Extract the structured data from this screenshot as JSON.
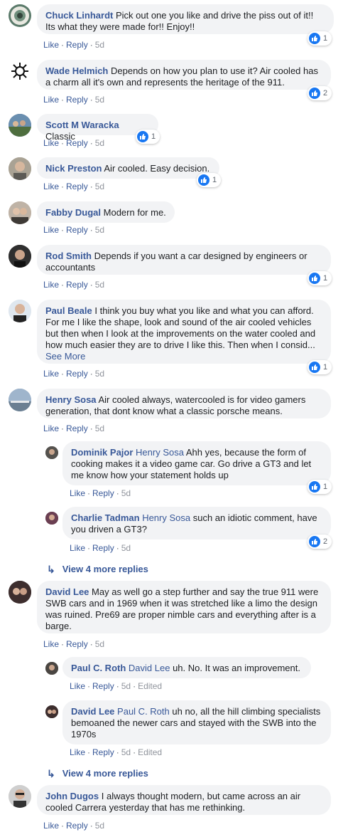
{
  "colors": {
    "link": "#385898",
    "bubble": "#f2f3f5",
    "like": "#1877f2",
    "meta": "#606770"
  },
  "actions": {
    "like": "Like",
    "reply": "Reply",
    "sep": "·"
  },
  "comments": [
    {
      "author": "Chuck Linhardt",
      "text": "Pick out one you like and drive the piss out of it!! Its what they were made for!! Enjoy!!",
      "time": "5d",
      "reactions": "1"
    },
    {
      "author": "Wade Helmich",
      "text": "Depends on how you plan to use it? Air cooled has a charm all it's own and represents the heritage of the 911.",
      "time": "5d",
      "reactions": "2"
    },
    {
      "author": "Scott M Waracka",
      "text": "Classic",
      "time": "5d",
      "reactions": "1"
    },
    {
      "author": "Nick Preston",
      "text": "Air cooled. Easy decision.",
      "time": "5d",
      "reactions": "1"
    },
    {
      "author": "Fabby Dugal",
      "text": "Modern for me.",
      "time": "5d"
    },
    {
      "author": "Rod Smith",
      "text": "Depends if you want a car designed by engineers or accountants",
      "time": "5d",
      "reactions": "1"
    },
    {
      "author": "Paul Beale",
      "text": "I think you buy what you like and what you can afford. For me I like the shape, look and sound of the air cooled vehicles but then when I look at the improvements on the water cooled and how much easier they are to drive I like this. Then when I consid...",
      "see_more": "See More",
      "time": "5d",
      "reactions": "1"
    },
    {
      "author": "Henry Sosa",
      "text": "Air cooled always, watercooled is for video gamers generation, that dont know what a classic porsche means.",
      "time": "5d"
    },
    {
      "author": "David Lee",
      "text": "May as well go a step further and say the true 911 were SWB cars and in 1969 when it was stretched like a limo the design was ruined. Pre69 are proper nimble cars and everything after is a barge.",
      "time": "5d"
    },
    {
      "author": "John Dugos",
      "text": "I always thought modern, but came across an air cooled Carrera yesterday that has me rethinking.",
      "time": "5d"
    }
  ],
  "replies": [
    {
      "author": "Dominik Pajor",
      "mention": "Henry Sosa",
      "text": "Ahh yes, because the form of cooking makes it a video game car. Go drive a GT3 and let me know how your statement holds up",
      "time": "5d",
      "reactions": "1"
    },
    {
      "author": "Charlie Tadman",
      "mention": "Henry Sosa",
      "text": "such an idiotic comment, have you driven a GT3?",
      "time": "5d",
      "reactions": "2"
    },
    {
      "author": "Paul C. Roth",
      "mention": "David Lee",
      "text": "uh. No. It was an improvement.",
      "time": "5d",
      "edited": "Edited"
    },
    {
      "author": "David Lee",
      "mention": "Paul C. Roth",
      "text": "uh no, all the hill climbing specialists bemoaned the newer cars and stayed with the SWB into the 1970s",
      "time": "5d",
      "edited": "Edited"
    }
  ],
  "more_replies": [
    "View 4 more replies",
    "View 4 more replies"
  ]
}
